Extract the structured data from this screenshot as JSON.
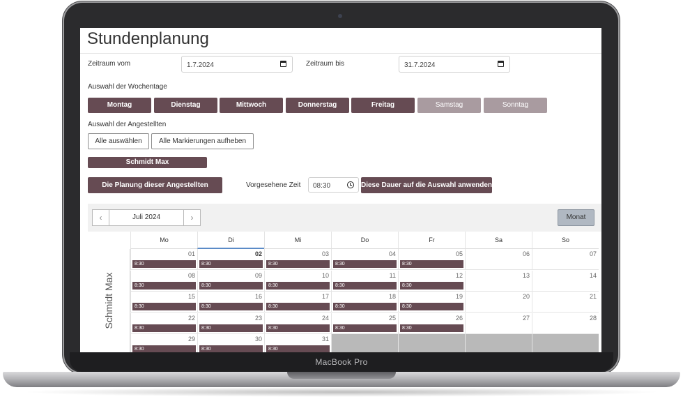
{
  "device": {
    "brand": "MacBook Pro"
  },
  "app": {
    "title": "Stundenplanung",
    "zeitraum_vom_label": "Zeitraum vom",
    "zeitraum_vom_value": "1.7.2024",
    "zeitraum_bis_label": "Zeitraum bis",
    "zeitraum_bis_value": "31.7.2024",
    "wochentage_label": "Auswahl der Wochentage",
    "weekdays": [
      {
        "label": "Montag",
        "selected": true
      },
      {
        "label": "Dienstag",
        "selected": true
      },
      {
        "label": "Mittwoch",
        "selected": true
      },
      {
        "label": "Donnerstag",
        "selected": true
      },
      {
        "label": "Freitag",
        "selected": true
      },
      {
        "label": "Samstag",
        "selected": false
      },
      {
        "label": "Sonntag",
        "selected": false
      }
    ],
    "angestellte_label": "Auswahl der Angestellten",
    "select_all_label": "Alle auswählen",
    "clear_all_label": "Alle Markierungen aufheben",
    "employee_name": "Schmidt Max",
    "open_plan_label": "Die Planung dieser Angestellten aufrufen",
    "vorgesehene_zeit_label": "Vorgesehene Zeit",
    "vorgesehene_zeit_value": "08:30",
    "apply_duration_label": "Diese Dauer auf die Auswahl anwenden"
  },
  "scheduler": {
    "period_label": "Juli 2024",
    "prev_symbol": "‹",
    "next_symbol": "›",
    "view_label": "Monat",
    "resource": "Schmidt Max",
    "day_headers": [
      "Mo",
      "Di",
      "Mi",
      "Do",
      "Fr",
      "Sa",
      "So"
    ],
    "selected_header": "Di",
    "today": "02",
    "event_label": "8:30",
    "weeks": [
      [
        "01",
        "02",
        "03",
        "04",
        "05",
        "06",
        "07"
      ],
      [
        "08",
        "09",
        "10",
        "11",
        "12",
        "13",
        "14"
      ],
      [
        "15",
        "16",
        "17",
        "18",
        "19",
        "20",
        "21"
      ],
      [
        "22",
        "23",
        "24",
        "25",
        "26",
        "27",
        "28"
      ],
      [
        "29",
        "30",
        "31",
        "",
        "",
        "",
        ""
      ]
    ]
  },
  "colors": {
    "primary": "#664b53",
    "disabled": "#a99ba0",
    "view_button": "#b0b8c2",
    "out_of_month": "#b9b9b9",
    "selected_header_line": "#5b8bc7"
  }
}
